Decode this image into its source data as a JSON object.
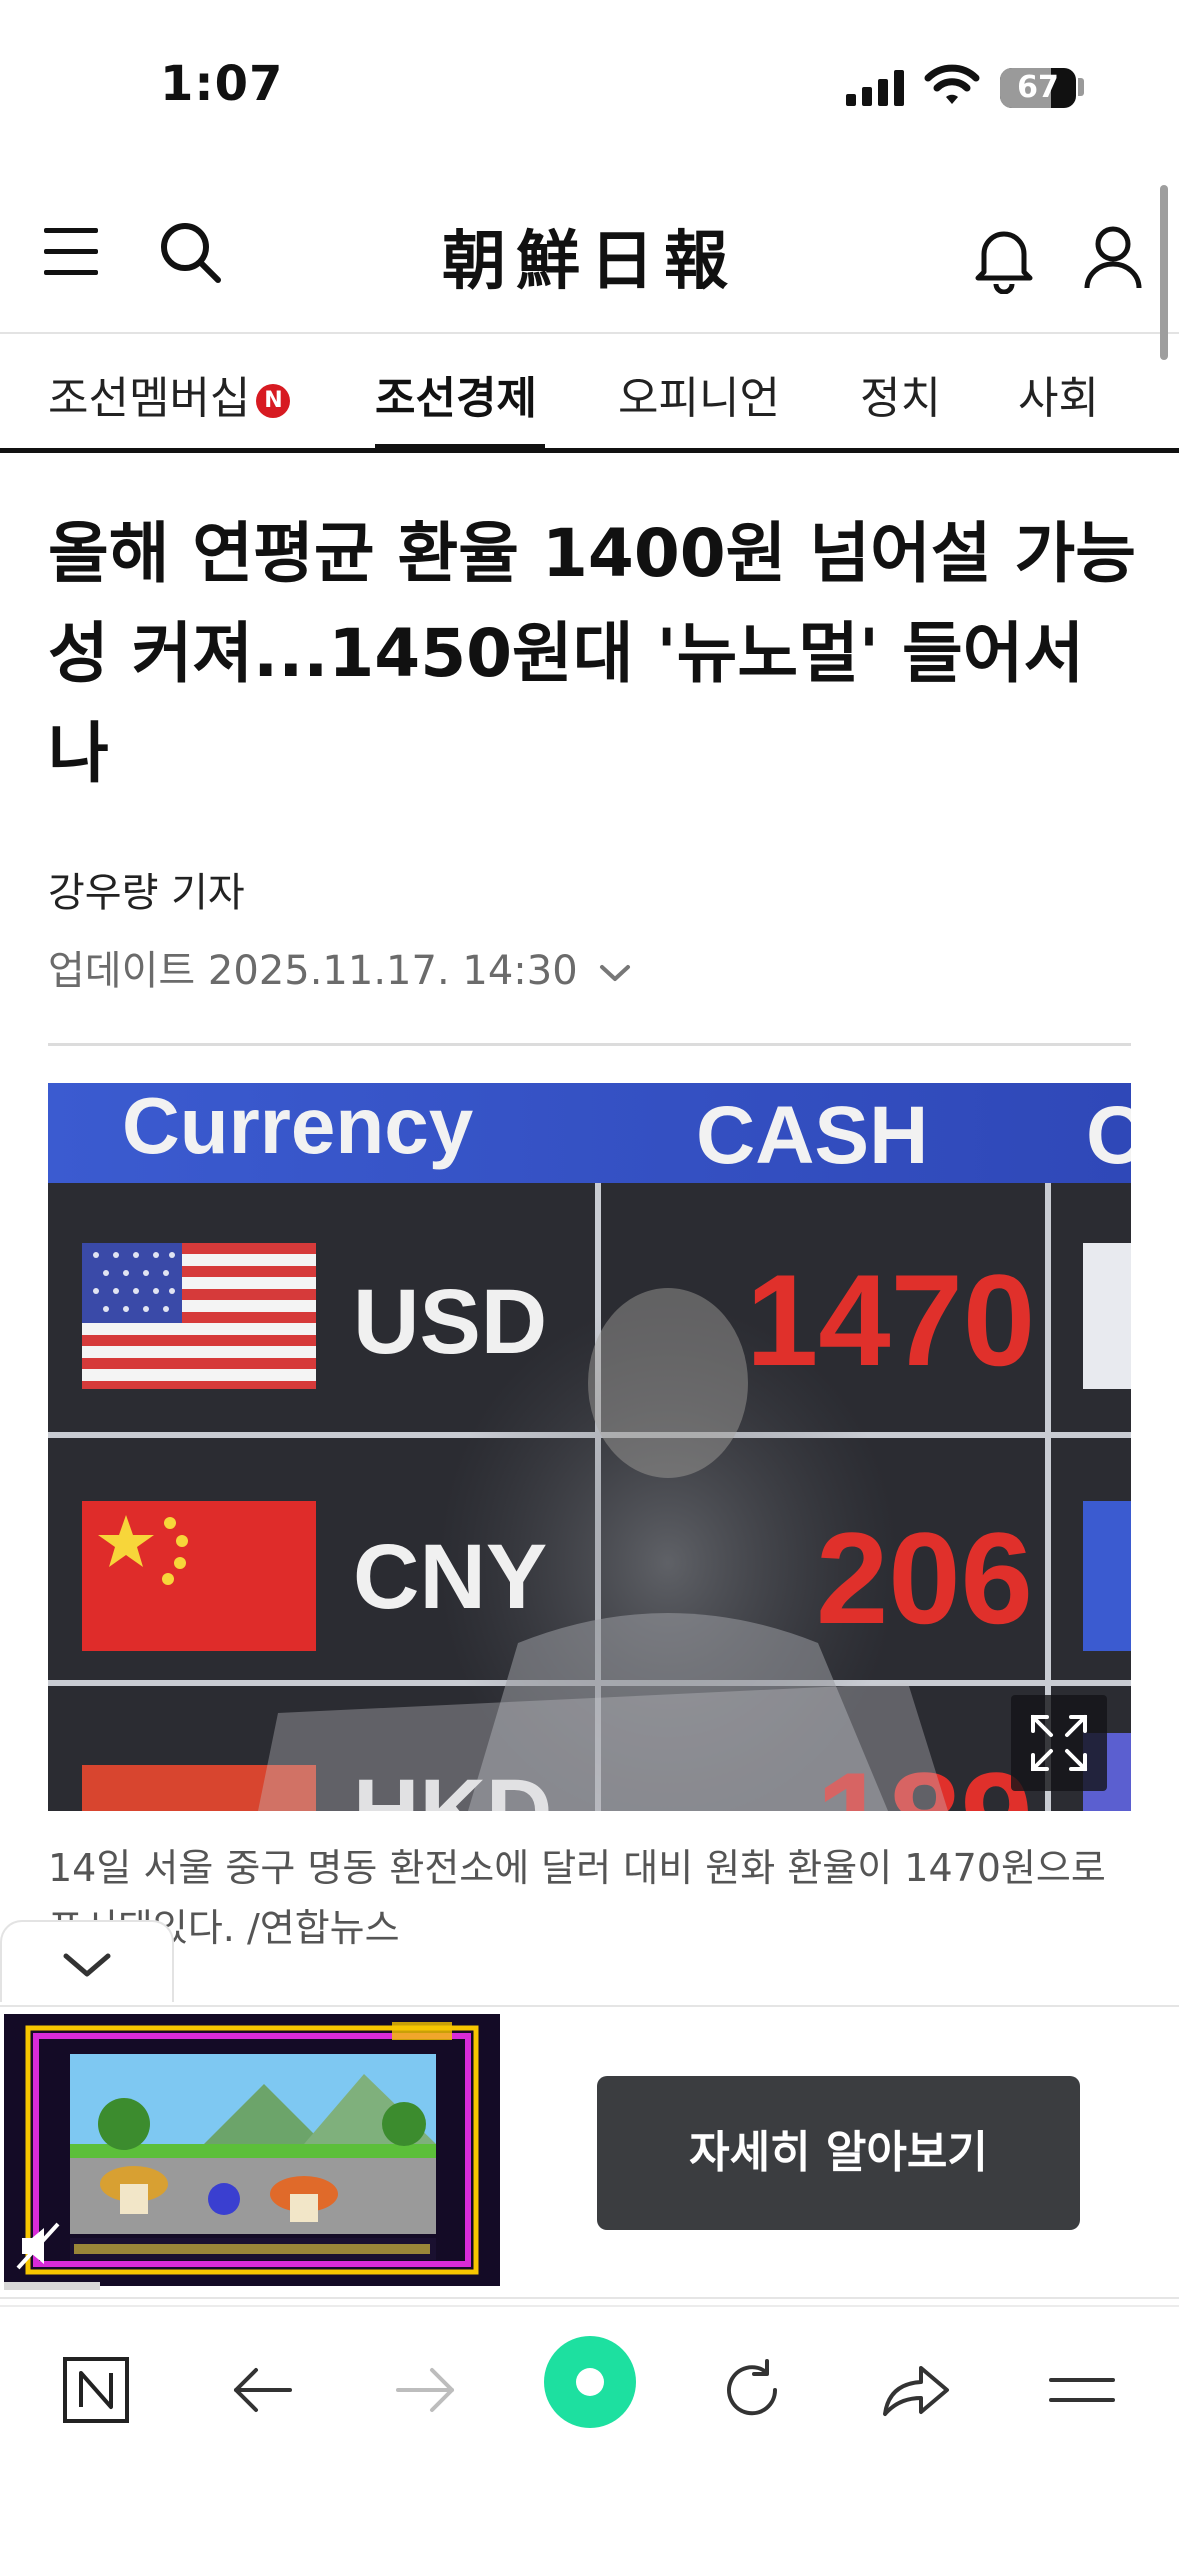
{
  "status_bar": {
    "time": "1:07",
    "battery": "67",
    "battery_level": 0.67
  },
  "header": {
    "logo": "朝鮮日報"
  },
  "nav": {
    "tabs": [
      {
        "label": "조선멤버십",
        "badge": "N"
      },
      {
        "label": "조선경제",
        "active": true
      },
      {
        "label": "오피니언"
      },
      {
        "label": "정치"
      },
      {
        "label": "사회"
      }
    ]
  },
  "article": {
    "headline": "올해 연평균 환율 1400원 넘어설 가능성 커져...1450원대 '뉴노멀' 들어서나",
    "byline": "강우량 기자",
    "updated": "업데이트 2025.11.17. 14:30",
    "photo": {
      "board_header_left": "Currency",
      "board_header_right": "CASH",
      "rows": [
        {
          "code": "USD",
          "rate": "1470"
        },
        {
          "code": "CNY",
          "rate": "206"
        }
      ]
    },
    "caption": "14일 서울 중구 명동 환전소에 달러 대비 원화 환율이 1470원으로 표시돼있다. /연합뉴스"
  },
  "ad": {
    "cta": "자세히 알아보기"
  },
  "colors": {
    "badge_red": "#d71a21",
    "record_green": "#1de0a0",
    "cta_bg": "#3b3d40"
  }
}
